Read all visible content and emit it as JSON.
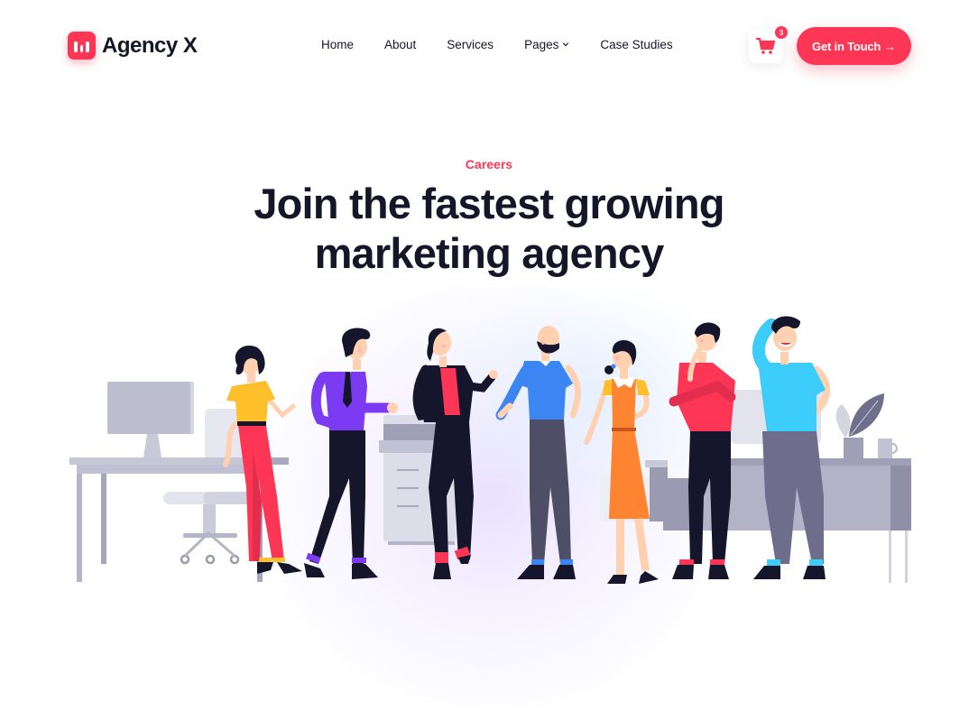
{
  "brand": {
    "name": "Agency X",
    "logo_icon": "bar-chart-icon",
    "accent_color": "#FE3656",
    "text_color": "#161629"
  },
  "nav": {
    "items": [
      {
        "label": "Home"
      },
      {
        "label": "About"
      },
      {
        "label": "Services"
      },
      {
        "label": "Pages",
        "has_dropdown": true,
        "dropdown_icon": "chevron-down-icon"
      },
      {
        "label": "Case Studies"
      }
    ]
  },
  "cart": {
    "icon": "shopping-cart-icon",
    "count": "3"
  },
  "cta": {
    "label": "Get in Touch",
    "icon": "arrow-right-icon",
    "arrow": "→"
  },
  "hero": {
    "eyebrow": "Careers",
    "title_line1": "Join the fastest growing",
    "title_line2": "marketing agency"
  },
  "illustration": {
    "description": "Team of seven people standing in an office with desks, computer monitors, an office chair, a printer, a plant and a mug",
    "people": [
      {
        "shirt": "#FDC02B",
        "pants": "#FE3656"
      },
      {
        "shirt": "#7A3BF2",
        "pants": "#15152B"
      },
      {
        "shirt": "#FE3656",
        "pants": "#15152B",
        "jacket": "#15152B"
      },
      {
        "shirt": "#3B86F2",
        "pants": "#4E4E66"
      },
      {
        "shirt": "#FF8431",
        "pants": "#FF8431"
      },
      {
        "shirt": "#FE3656",
        "pants": "#15152B"
      },
      {
        "shirt": "#3DCDFA",
        "pants": "#6E6E8C"
      }
    ]
  }
}
